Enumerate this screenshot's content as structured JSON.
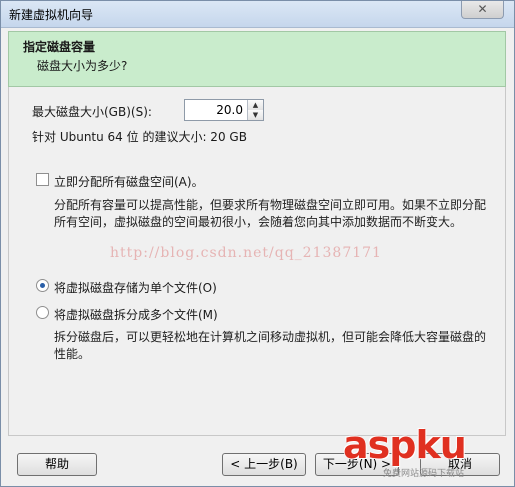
{
  "window": {
    "title": "新建虚拟机向导"
  },
  "header": {
    "title": "指定磁盘容量",
    "subtitle": "磁盘大小为多少?"
  },
  "disk": {
    "max_size_label": "最大磁盘大小(GB)(S):",
    "max_size_value": "20.0",
    "recommend_text": "针对 Ubuntu 64 位 的建议大小: 20 GB"
  },
  "allocate": {
    "label": "立即分配所有磁盘空间(A)。",
    "checked": false,
    "desc_line1": "分配所有容量可以提高性能，但要求所有物理磁盘空间立即可用。如果不立即分配",
    "desc_line2": "所有空间，虚拟磁盘的空间最初很小，会随着您向其中添加数据而不断变大。"
  },
  "watermark": "http://blog.csdn.net/qq_21387171",
  "options": {
    "single": {
      "label": "将虚拟磁盘存储为单个文件(O)",
      "selected": true
    },
    "multi": {
      "label": "将虚拟磁盘拆分成多个文件(M)",
      "selected": false,
      "desc_line1": "拆分磁盘后，可以更轻松地在计算机之间移动虚拟机，但可能会降低大容量磁盘的",
      "desc_line2": "性能。"
    }
  },
  "buttons": {
    "help": "帮助",
    "back": "< 上一步(B)",
    "next": "下一步(N) >",
    "cancel": "取消"
  },
  "logo": {
    "main": "aspku",
    "sub": "免费网站源码下载站"
  }
}
